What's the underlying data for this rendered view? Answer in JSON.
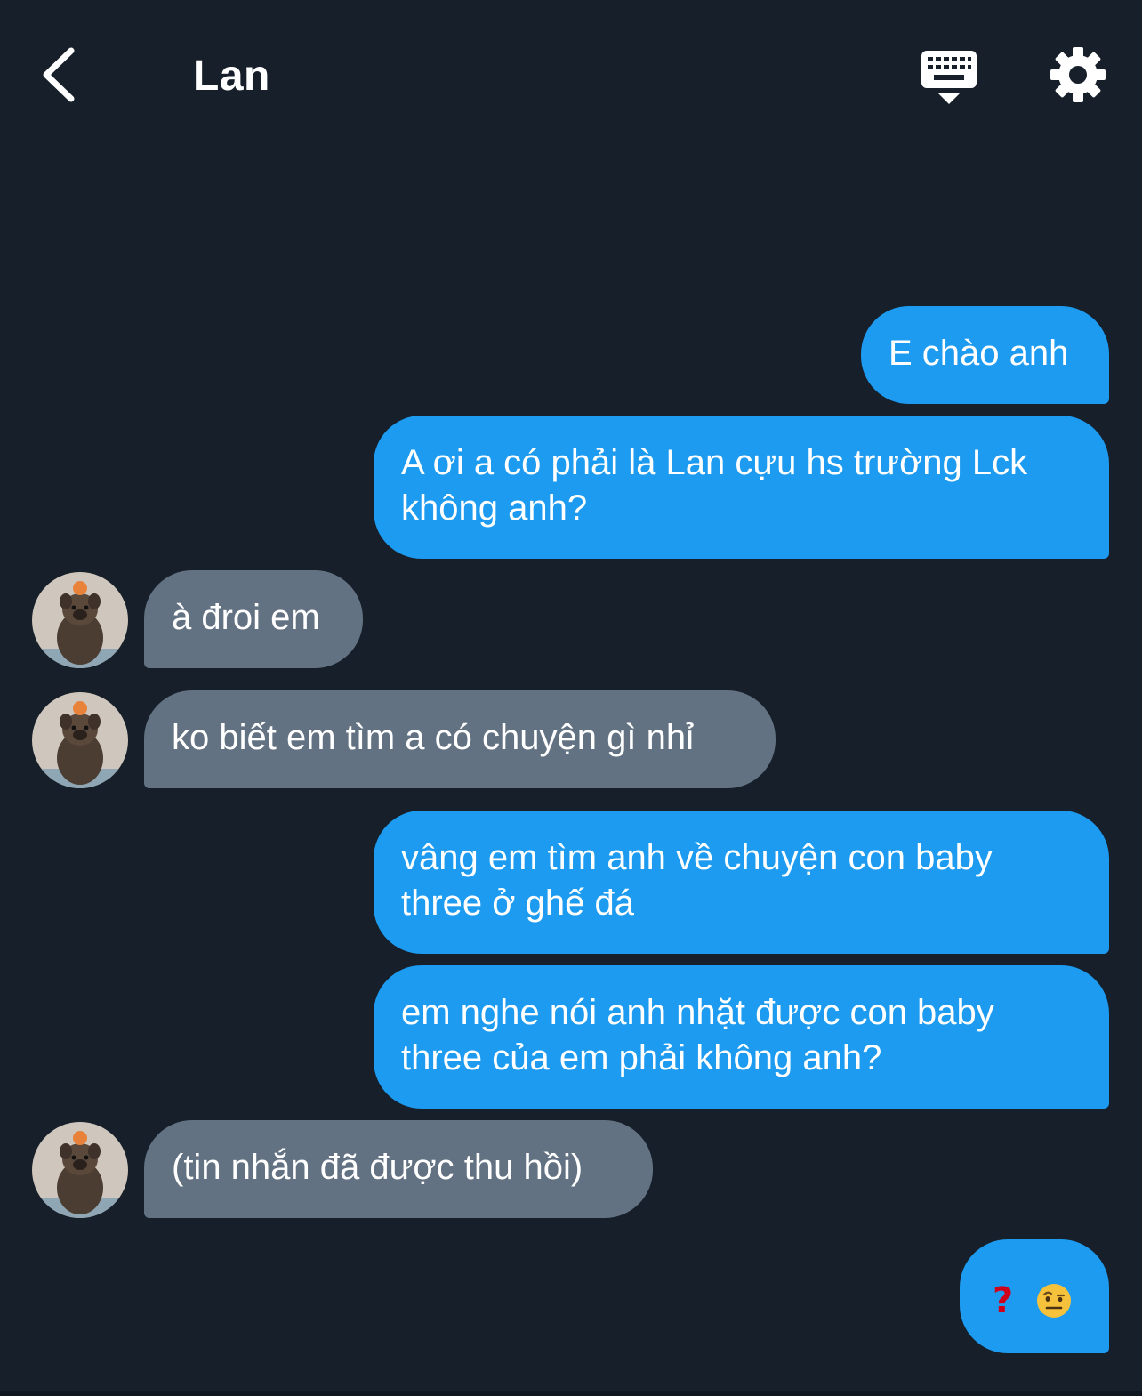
{
  "header": {
    "title": "Lan",
    "back_icon": "chevron-left-icon",
    "keyboard_icon": "keyboard-icon",
    "settings_icon": "gear-icon"
  },
  "colors": {
    "background": "#161F2A",
    "sent_bubble": "#1D9BF0",
    "received_bubble": "#637282",
    "text": "#FFFFFF"
  },
  "messages": [
    {
      "sender": "me",
      "lines": [
        "E chào anh"
      ]
    },
    {
      "sender": "me",
      "lines": [
        "A ơi a có phải là Lan cựu hs trường Lck",
        "không anh?"
      ]
    },
    {
      "sender": "Lan",
      "lines": [
        "à đroi em"
      ]
    },
    {
      "sender": "Lan",
      "lines": [
        "ko biết em tìm a có chuyện gì nhỉ"
      ]
    },
    {
      "sender": "me",
      "lines": [
        "vâng em tìm anh về chuyện con baby",
        "three ở ghế đá"
      ]
    },
    {
      "sender": "me",
      "lines": [
        "em nghe nói anh nhặt được con baby",
        "three của em phải không anh?"
      ]
    },
    {
      "sender": "Lan",
      "lines": [
        "(tin nhắn đã được thu hồi)"
      ]
    },
    {
      "sender": "me",
      "emoji": [
        "red-question-mark",
        "face-with-raised-eyebrow"
      ]
    }
  ]
}
